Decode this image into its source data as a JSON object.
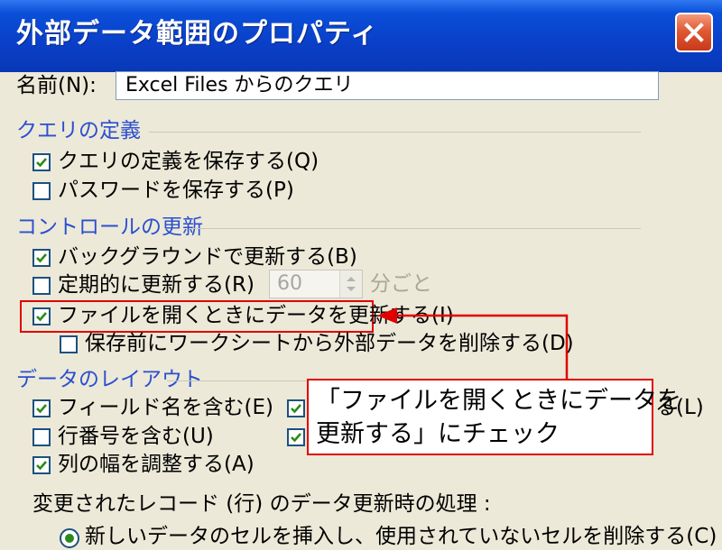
{
  "window": {
    "title": "外部データ範囲のプロパティ"
  },
  "name": {
    "label": "名前(N):",
    "value": "Excel Files からのクエリ"
  },
  "query_definition": {
    "heading": "クエリの定義",
    "save_query": {
      "label": "クエリの定義を保存する(Q)",
      "checked": true
    },
    "save_password": {
      "label": "パスワードを保存する(P)",
      "checked": false
    }
  },
  "refresh_control": {
    "heading": "コントロールの更新",
    "background_refresh": {
      "label": "バックグラウンドで更新する(B)",
      "checked": true
    },
    "periodic_refresh": {
      "label": "定期的に更新する(R)",
      "checked": false,
      "interval": "60",
      "unit": "分ごと"
    },
    "refresh_on_open": {
      "label": "ファイルを開くときにデータを更新する(I)",
      "checked": true
    },
    "remove_before_save": {
      "label": "保存前にワークシートから外部データを削除する(D)",
      "checked": false
    }
  },
  "data_layout": {
    "heading": "データのレイアウト",
    "include_field_names": {
      "label": "フィールド名を含む(E)",
      "checked": true
    },
    "include_row_numbers": {
      "label": "行番号を含む(U)",
      "checked": false
    },
    "adjust_column_width": {
      "label": "列の幅を調整する(A)",
      "checked": true
    },
    "right_col_1": {
      "checked": true,
      "label_tail": "る(L)"
    },
    "right_col_2": {
      "checked": true
    }
  },
  "record_change": {
    "label": "変更されたレコード (行) のデータ更新時の処理 :",
    "option_1": "新しいデータのセルを挿入し、使用されていないセルを削除する(C)"
  },
  "annotation": {
    "line1": "「ファイルを開くときにデータを",
    "line2": "更新する」にチェック",
    "color": "#e00000"
  },
  "colors": {
    "title_bar": "#0a3fc8",
    "section_heading": "#2b4fd0",
    "check_mark": "#2b8a1a"
  }
}
